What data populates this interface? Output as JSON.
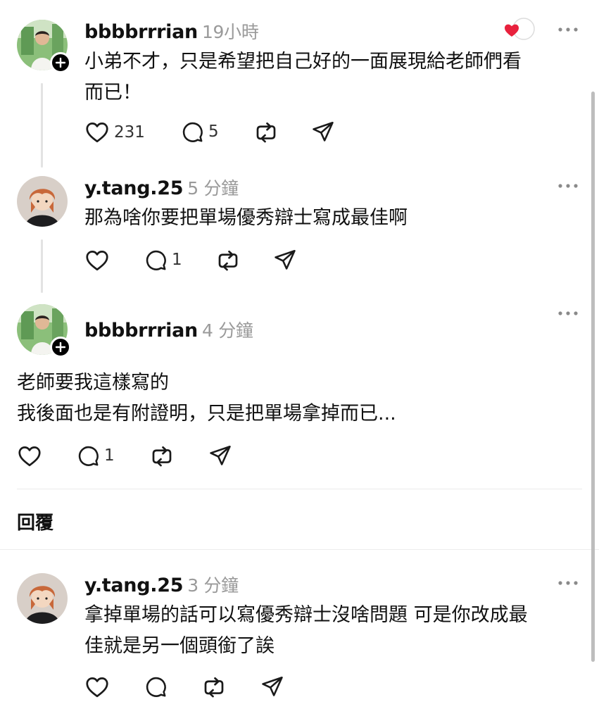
{
  "posts": [
    {
      "username": "bbbbrrrian",
      "time": "19小時",
      "lines": [
        "小弟不才，只是希望把自己好的一面展現給老師們看",
        "而已！"
      ],
      "likes": "231",
      "replies": "5"
    },
    {
      "username": "y.tang.25",
      "time": "5 分鐘",
      "lines": [
        "那為啥你要把單場優秀辯士寫成最佳啊"
      ],
      "likes": "",
      "replies": "1"
    },
    {
      "username": "bbbbrrrian",
      "time": "4 分鐘",
      "lines": [
        "老師要我這樣寫的",
        "我後面也是有附證明，只是把單場拿掉而已..."
      ],
      "likes": "",
      "replies": "1"
    },
    {
      "username": "y.tang.25",
      "time": "3 分鐘",
      "lines": [
        "拿掉單場的話可以寫優秀辯士沒啥問題 可是你改成最",
        "佳就是另一個頭銜了誒"
      ],
      "likes": "",
      "replies": ""
    }
  ],
  "replies_section": {
    "title": "回覆"
  },
  "colors": {
    "heart": "#e8213d",
    "muted": "#9a9a9a",
    "divider": "#ececec"
  },
  "icons": [
    "heart-icon",
    "comment-icon",
    "repost-icon",
    "share-icon",
    "more-icon",
    "plus-icon"
  ]
}
